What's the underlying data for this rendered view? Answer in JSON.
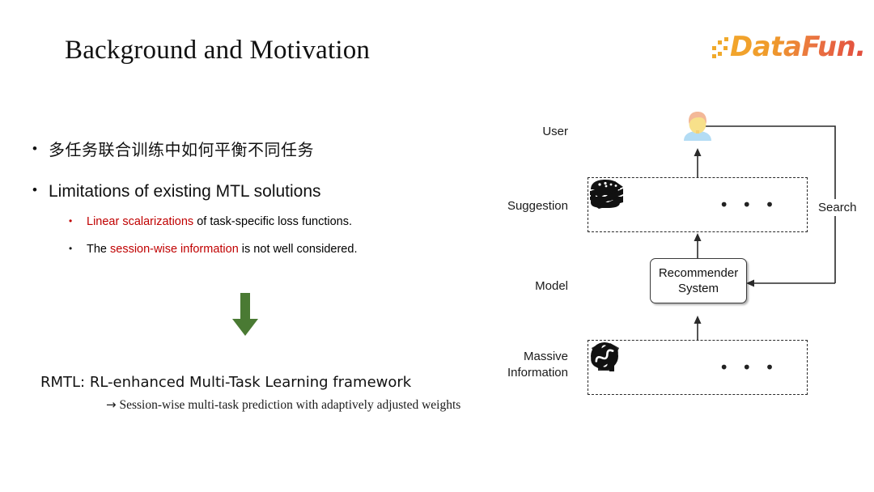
{
  "slide": {
    "title": "Background and Motivation",
    "background_color": "#ffffff"
  },
  "logo": {
    "text": "DataFun.",
    "dots_icon": "pixel-dots-icon",
    "gradient_from": "#f2a72c",
    "gradient_to": "#e04a3c"
  },
  "content": {
    "bullets": [
      {
        "marker": "•",
        "text": "多任务联合训练中如何平衡不同任务"
      },
      {
        "marker": "•",
        "text": "Limitations of existing MTL solutions"
      }
    ],
    "sub_bullets": [
      {
        "marker": "•",
        "marker_color": "#C00000",
        "highlight": "Linear scalarizations",
        "rest": " of task-specific loss functions."
      },
      {
        "marker": "•",
        "marker_color": "#1a1a1a",
        "prefix": "The ",
        "highlight": "session-wise information",
        "rest": " is not well considered."
      }
    ],
    "highlight_color": "#C00000",
    "arrow_icon": "green-down-arrow-icon",
    "arrow_color": "#4a7a33",
    "conclusion_title": "RMTL: RL-enhanced Multi-Task Learning framework",
    "conclusion_arrow": "→",
    "conclusion_sub": "Session-wise multi-task prediction with adaptively adjusted weights"
  },
  "diagram": {
    "labels": {
      "user": "User",
      "suggestion": "Suggestion",
      "model": "Model",
      "massive_line1": "Massive",
      "massive_line2": "Information",
      "search": "Search"
    },
    "model_box": {
      "line1": "Recommender",
      "line2": "System"
    },
    "suggestion_items": [
      {
        "icon": "hotdog-icon"
      },
      {
        "icon": "hamburger-icon"
      },
      {
        "icon": "cake-slice-icon"
      },
      {
        "icon": "ellipsis-icon",
        "text": "• • •"
      }
    ],
    "massive_items": [
      {
        "icon": "tshirt-icon"
      },
      {
        "icon": "film-reel-icon"
      },
      {
        "icon": "hotdog-icon"
      },
      {
        "icon": "ellipsis-icon",
        "text": "• • •"
      }
    ],
    "avatar_icon": "user-avatar-icon",
    "line_color": "#2a2a2a"
  }
}
